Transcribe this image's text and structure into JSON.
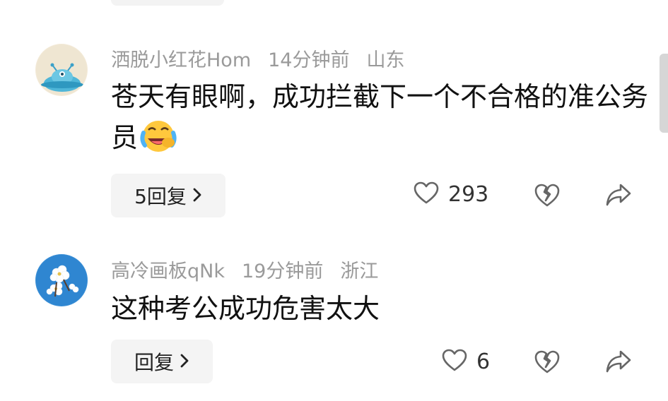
{
  "comments": [
    {
      "username": "洒脱小红花Hom",
      "time": "14分钟前",
      "location": "山东",
      "text": "苍天有眼啊，成功拦截下一个不合格的准公务员",
      "emoji": "laugh-cry-emoji",
      "reply_label": "5回复",
      "likes": "293",
      "avatar": "blue-ufo-avatar"
    },
    {
      "username": "高冷画板qNk",
      "time": "19分钟前",
      "location": "浙江",
      "text": "这种考公成功危害太大",
      "reply_label": "回复",
      "likes": "6",
      "avatar": "white-flower-avatar"
    }
  ],
  "colors": {
    "meta": "#9a9a9a",
    "text": "#111111",
    "chip": "#f4f4f4",
    "icon": "#666666"
  }
}
